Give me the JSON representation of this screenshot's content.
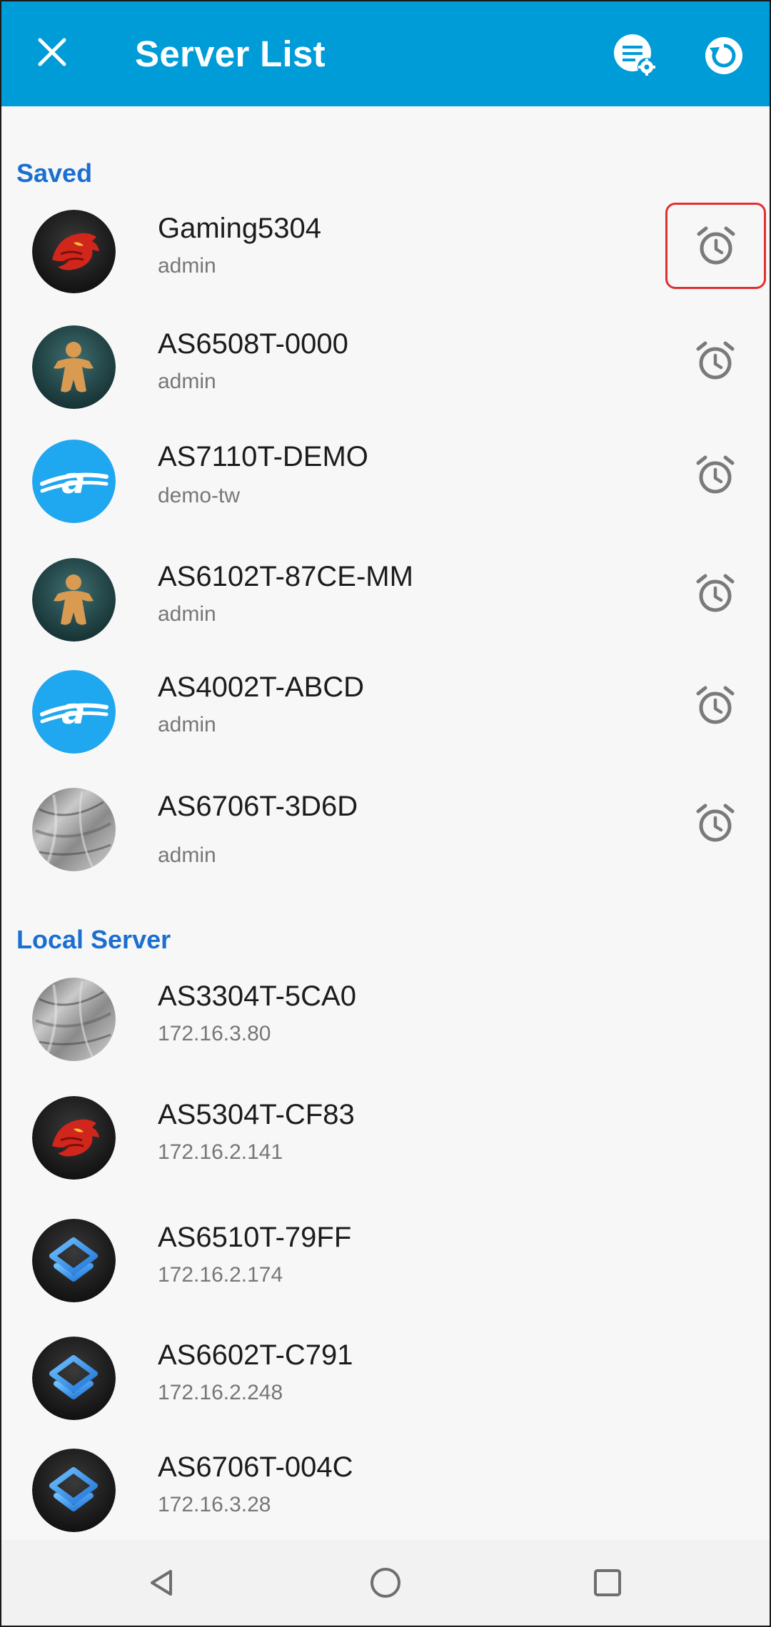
{
  "app_bar": {
    "title": "Server List",
    "background_color": "#009cd8",
    "close_icon": "close-icon",
    "settings_icon": "list-settings-icon",
    "refresh_icon": "refresh-icon"
  },
  "sections": {
    "saved": {
      "label": "Saved"
    },
    "local": {
      "label": "Local Server"
    }
  },
  "saved_servers": [
    {
      "name": "Gaming5304",
      "sub": "admin",
      "avatar": "dragon-avatar",
      "action_icon": "alarm-clock-icon",
      "selected": true
    },
    {
      "name": "AS6508T-0000",
      "sub": "admin",
      "avatar": "person-avatar",
      "action_icon": "alarm-clock-icon"
    },
    {
      "name": "AS7110T-DEMO",
      "sub": "demo-tw",
      "avatar": "asustor-logo-avatar",
      "action_icon": "alarm-clock-icon"
    },
    {
      "name": "AS6102T-87CE-MM",
      "sub": "admin",
      "avatar": "person-avatar",
      "action_icon": "alarm-clock-icon"
    },
    {
      "name": "AS4002T-ABCD",
      "sub": "admin",
      "avatar": "asustor-logo-avatar",
      "action_icon": "alarm-clock-icon"
    },
    {
      "name": "AS6706T-3D6D",
      "sub": "admin",
      "avatar": "texture-avatar",
      "action_icon": "alarm-clock-icon"
    }
  ],
  "local_servers": [
    {
      "name": "AS3304T-5CA0",
      "sub": "172.16.3.80",
      "avatar": "texture-avatar"
    },
    {
      "name": "AS5304T-CF83",
      "sub": "172.16.2.141",
      "avatar": "dragon-avatar"
    },
    {
      "name": "AS6510T-79FF",
      "sub": "172.16.2.174",
      "avatar": "layers-logo-avatar"
    },
    {
      "name": "AS6602T-C791",
      "sub": "172.16.2.248",
      "avatar": "layers-logo-avatar"
    },
    {
      "name": "AS6706T-004C",
      "sub": "172.16.3.28",
      "avatar": "layers-logo-avatar"
    }
  ],
  "nav_bar": {
    "back_icon": "back-triangle-icon",
    "home_icon": "home-circle-icon",
    "recents_icon": "recents-square-icon"
  },
  "colors": {
    "accent": "#009cd8",
    "section_header": "#1a6fd0",
    "selection_outline": "#e03030",
    "icon_gray": "#7a7a7a"
  }
}
